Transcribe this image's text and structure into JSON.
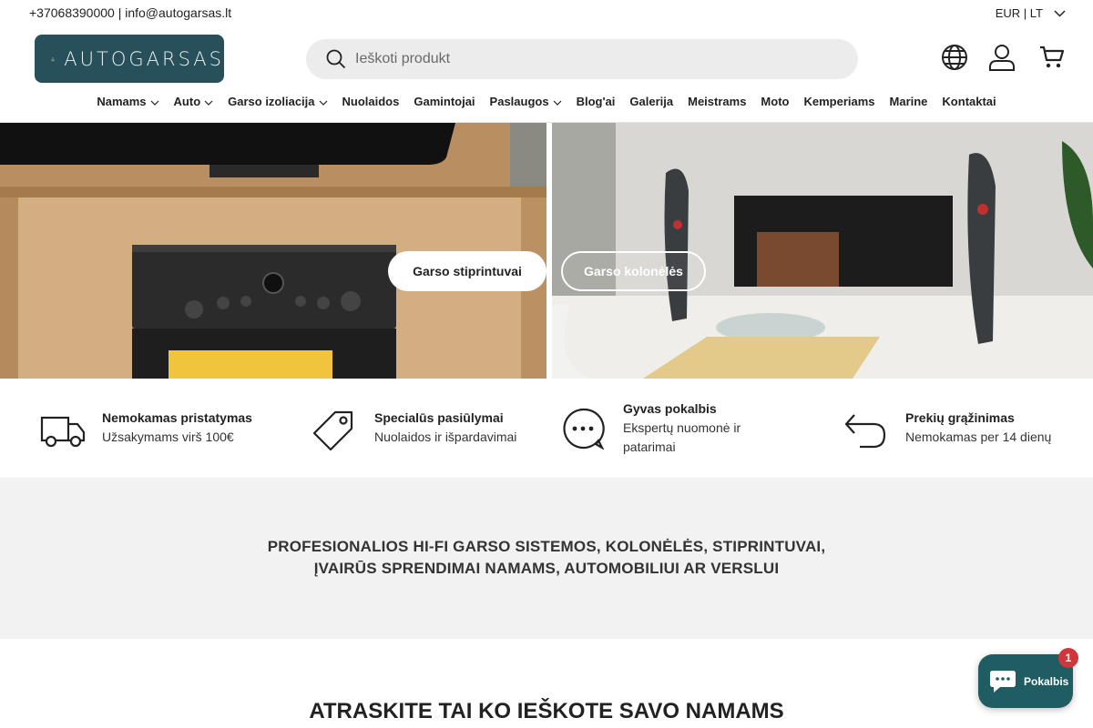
{
  "topbar": {
    "contact": "+37068390000 | info@autogarsas.lt",
    "locale": "EUR | LT"
  },
  "brand": {
    "logo_text": "AUTOGARSAS"
  },
  "search": {
    "placeholder": "Ieškoti produkt"
  },
  "header_icons": [
    "globe-icon",
    "account-icon",
    "cart-icon"
  ],
  "nav": {
    "items": [
      {
        "label": "Namams",
        "has_dropdown": true
      },
      {
        "label": "Auto",
        "has_dropdown": true
      },
      {
        "label": "Garso izoliacija",
        "has_dropdown": true
      },
      {
        "label": "Nuolaidos",
        "has_dropdown": false
      },
      {
        "label": "Gamintojai",
        "has_dropdown": false
      },
      {
        "label": "Paslaugos",
        "has_dropdown": true
      },
      {
        "label": "Blog'ai",
        "has_dropdown": false
      },
      {
        "label": "Galerija",
        "has_dropdown": false
      },
      {
        "label": "Meistrams",
        "has_dropdown": false
      },
      {
        "label": "Moto",
        "has_dropdown": false
      },
      {
        "label": "Kemperiams",
        "has_dropdown": false
      },
      {
        "label": "Marine",
        "has_dropdown": false
      },
      {
        "label": "Kontaktai",
        "has_dropdown": false
      }
    ]
  },
  "hero": {
    "left_button": "Garso stiprintuvai",
    "right_button": "Garso kolonėlės"
  },
  "features": [
    {
      "icon": "truck-icon",
      "title": "Nemokamas pristatymas",
      "subtitle": "Užsakymams virš 100€"
    },
    {
      "icon": "tag-icon",
      "title": "Specialūs pasiūlymai",
      "subtitle": "Nuolaidos ir išpardavimai"
    },
    {
      "icon": "chat-bubble-icon",
      "title": "Gyvas pokalbis",
      "subtitle_line1": "Ekspertų nuomonė ir",
      "subtitle_line2": "patarimai"
    },
    {
      "icon": "return-arrow-icon",
      "title": "Prekių grąžinimas",
      "subtitle": "Nemokamas per 14 dienų"
    }
  ],
  "statement": {
    "line1": "PROFESIONALIOS HI-FI GARSO SISTEMOS, KOLONĖLĖS, STIPRINTUVAI,",
    "line2": "ĮVAIRŪS SPRENDIMAI NAMAMS, AUTOMOBILIUI AR VERSLUI"
  },
  "section": {
    "title": "ATRASKITE TAI KO IEŠKOTE SAVO NAMAMS"
  },
  "chat_widget": {
    "label": "Pokalbis",
    "badge": "1"
  },
  "colors": {
    "brand": "#27505a",
    "chat": "#1f5d63",
    "badge": "#d0373c"
  }
}
